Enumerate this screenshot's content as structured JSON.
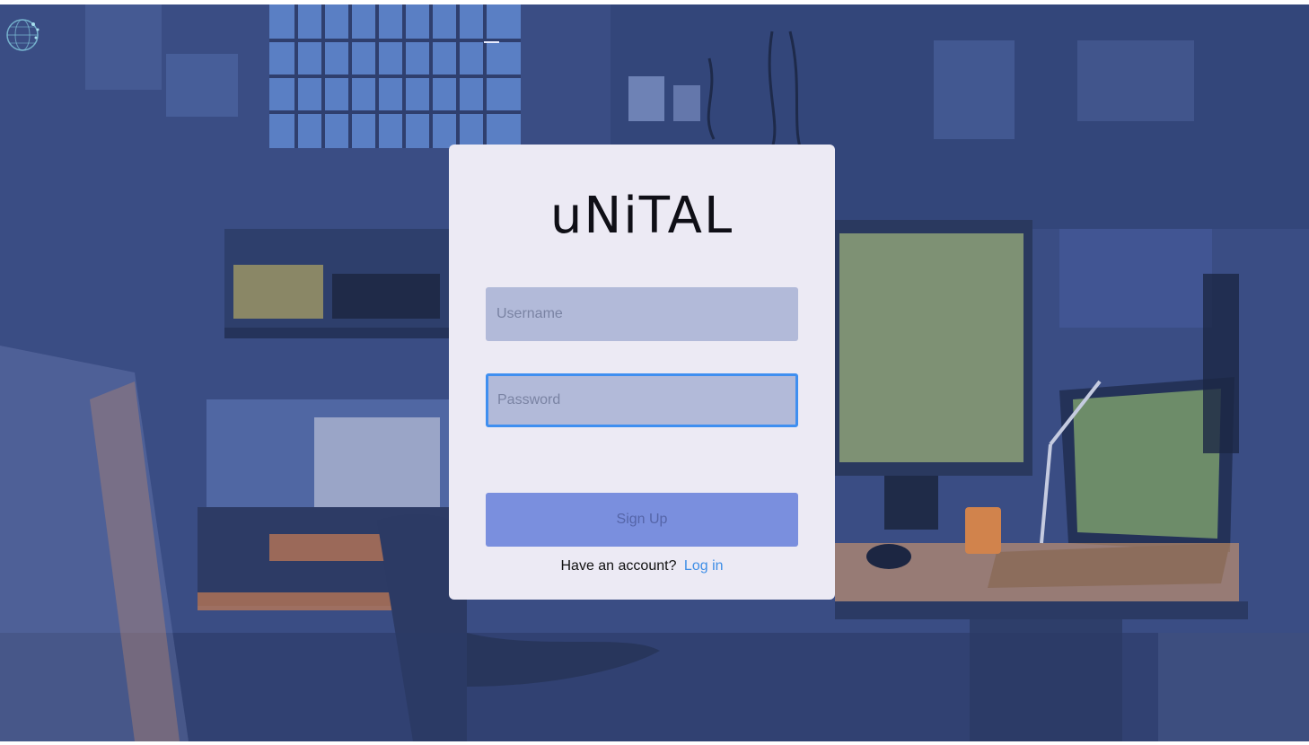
{
  "app": {
    "brand": "uNiTAL"
  },
  "form": {
    "username_placeholder": "Username",
    "password_placeholder": "Password",
    "submit_label": "Sign Up"
  },
  "footer": {
    "prompt": "Have an account?",
    "login_label": "Log in"
  },
  "colors": {
    "card_bg": "#eceaf4",
    "field_bg": "#b2bad9",
    "focus_ring": "#3f8ff0",
    "button_bg": "#7a8fde",
    "link": "#3e8ee6",
    "scene_base": "#34477a"
  },
  "icons": {
    "logo": "globe-network-icon"
  }
}
